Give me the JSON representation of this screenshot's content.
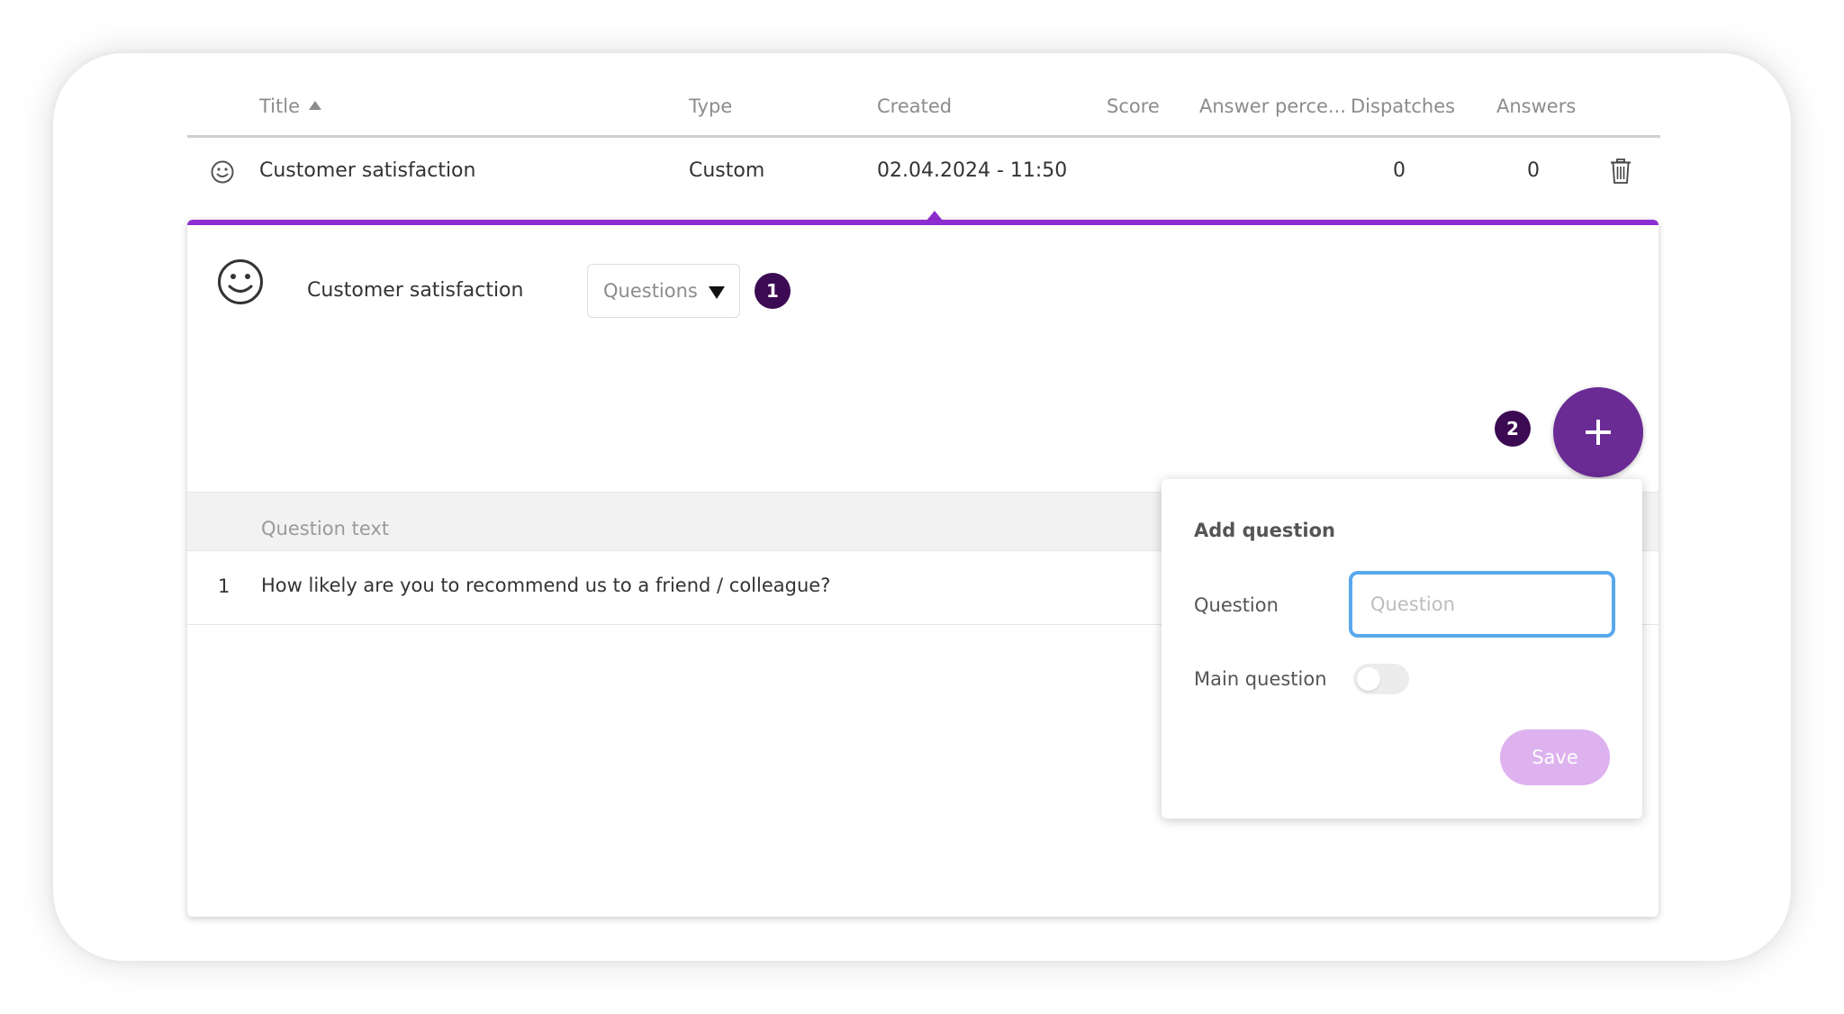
{
  "table": {
    "columns": {
      "title": "Title",
      "type": "Type",
      "created": "Created",
      "score": "Score",
      "answer_percentage": "Answer perce...",
      "dispatches": "Dispatches",
      "answers": "Answers"
    },
    "row": {
      "icon": "smiley-icon",
      "title": "Customer satisfaction",
      "type": "Custom",
      "created": "02.04.2024 - 11:50",
      "score": "",
      "answer_percentage": "",
      "dispatches": "0",
      "answers": "0"
    }
  },
  "detail": {
    "icon": "smiley-icon",
    "title": "Customer satisfaction",
    "view_dropdown": {
      "selected": "Questions"
    },
    "markers": [
      "1",
      "2"
    ],
    "questions_header": "Question text",
    "questions": [
      {
        "number": "1",
        "text": "How likely are you to recommend us to a friend / colleague?"
      }
    ]
  },
  "add_question": {
    "title": "Add question",
    "question_label": "Question",
    "question_placeholder": "Question",
    "question_value": "",
    "main_question_label": "Main question",
    "main_question_on": false,
    "save_label": "Save"
  },
  "colors": {
    "accent": "#8e2dd1",
    "fab": "#6a2b94",
    "marker": "#3c0a52",
    "save_disabled": "#ddb2ef",
    "input_focus": "#5aa8ec"
  }
}
